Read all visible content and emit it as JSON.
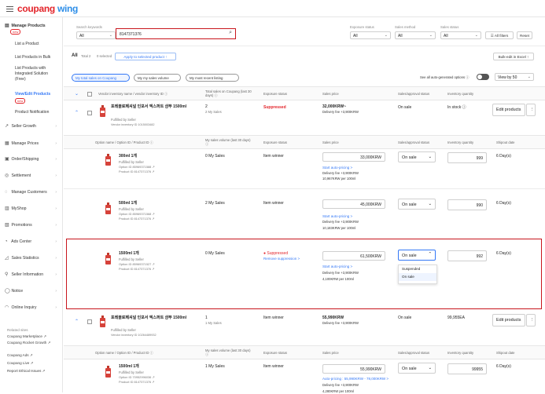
{
  "app": {
    "brand_a": "coupang",
    "brand_b": "wing"
  },
  "sidebar": {
    "manage_products": "Manage Products",
    "new_badge": "new",
    "subs": [
      "List a Product",
      "List Products in Bulk",
      "List Products with Integrated Solution (Free)",
      "View/Edit Products",
      "Product Notification"
    ],
    "items": [
      "Seller Growth",
      "Manage Prices",
      "Order/Shipping",
      "Settlement",
      "Manage Customers",
      "MyShop",
      "Promotions",
      "Ads Center",
      "Sales Statistics",
      "Seller Information",
      "Notice",
      "Online Inquiry"
    ],
    "related_title": "Related sites",
    "related": [
      "Coupang Marketplace ↗",
      "Coupang Rocket Growth ↗",
      "Coupang Ads ↗",
      "Coupang Live ↗",
      "Report Ethical Issues ↗"
    ]
  },
  "filters": {
    "search_label": "Search keywords",
    "search_scope": "All",
    "search_value": "8147371376",
    "exposure_label": "Exposure status",
    "exposure_value": "All",
    "method_label": "Sales method",
    "method_value": "All",
    "sales_label": "Sales status",
    "sales_value": "All",
    "all_filters": "All filters",
    "reset": "Reset"
  },
  "toolbar": {
    "all": "All",
    "total": "Total 2",
    "selected": "0 selected",
    "apply": "Apply to selected product ↑",
    "bulk_excel": "Bulk-edit in Excel ↑"
  },
  "pills": [
    "My total sales on Coupang",
    "My my sales volume",
    "My most recent listing"
  ],
  "autogen": "See all auto-generated options ⓘ",
  "view_by": "View by 50",
  "header": [
    "Vendor inventory name / vendor inventory ID ⓘ",
    "Total sales on Coupang (last 30 days) ⓘ",
    "Exposure status",
    "Sales price",
    "Sales/approval status",
    "Inventory quantity"
  ],
  "sub_header": [
    "Option name / Option ID / Product ID ⓘ",
    "My sales volume (last 30 days) ⓘ",
    "Exposure status",
    "Sales price",
    "Sales/approval status",
    "Inventory quantity",
    "Shipout date"
  ],
  "group1": {
    "name": "포레블로페셔널 인포서 엑스퍼트 샴푸 1500ml",
    "fulfill": "Fulfilled by Seller",
    "vid": "Vendor inventory ID 1015003482",
    "sales": "2",
    "sales_sub": "2 My Sales",
    "exposure": "Suppressed",
    "price": "32,000KRW~",
    "delivery": "Delivery fee +3,900KRW",
    "status": "On sale",
    "inventory": "In stock ⓘ",
    "edit": "Edit products"
  },
  "options": [
    {
      "name": "300ml 1개",
      "fulfill": "Fulfilled by Seller",
      "oid": "Option ID 85969371588 ↗",
      "pid": "Product ID 8147371376 ↗",
      "sales": "0 My Sales",
      "exposure": "Item winner",
      "price": "33,000KRW",
      "auto": "Start auto-pricing >",
      "delivery": "Delivery fee +3,900KRW",
      "unit": "10,967KRW per 100ml",
      "status": "On sale",
      "qty": "999",
      "ship": "6 Day(s)"
    },
    {
      "name": "500ml 1개",
      "fulfill": "Fulfilled by Seller",
      "oid": "Option ID 85969371568 ↗",
      "pid": "Product ID 8147371376 ↗",
      "sales": "2 My Sales",
      "exposure": "Item winner",
      "price": "45,000KRW",
      "auto": "Start auto-pricing >",
      "delivery": "Delivery fee +3,900KRW",
      "unit": "10,183KRW per 100ml",
      "status": "On sale",
      "qty": "990",
      "ship": "6 Day(s)"
    },
    {
      "name": "1500ml 1개",
      "fulfill": "Fulfilled by Seller",
      "oid": "Option ID 85969371527 ↗",
      "pid": "Product ID 8147371376 ↗",
      "sales": "0 My Sales",
      "exposure": "Suppressed",
      "remove": "Remove suppression >",
      "price": "61,500KRW",
      "auto": "Start auto-pricing >",
      "delivery": "Delivery fee +3,900KRW",
      "unit": "4,100KRW per 100ml",
      "status": "On sale",
      "qty": "992",
      "ship": "6 Day(s)"
    }
  ],
  "menu": [
    "Suspended",
    "On sale"
  ],
  "group2": {
    "name": "포레블로페셔널 인포서 엑스퍼트 샴푸 1500ml",
    "fulfill": "Fulfilled by Seller",
    "vid": "Vendor inventory ID 10264489932",
    "sales": "1",
    "sales_sub": "1 My Sales",
    "exposure": "Item winner",
    "price": "55,990KRW",
    "delivery": "Delivery fee +3,900KRW",
    "status": "On sale",
    "inventory": "99,955EA",
    "edit": "Edit products"
  },
  "option4": {
    "name": "1500ml 1개",
    "fulfill": "Fulfilled by Seller",
    "oid": "Option ID 70952996036 ↗",
    "pid": "Product ID 8147371376 ↗",
    "sales": "1 My Sales",
    "exposure": "Item winner",
    "price": "55,990KRW",
    "auto": "Auto-pricing : 55,990KRW - 78,000KRW >",
    "delivery": "Delivery fee +3,900KRW",
    "unit": "4,280KRW per 100ml",
    "status": "On sale",
    "qty": "99955",
    "ship": "6 Day(s)"
  }
}
